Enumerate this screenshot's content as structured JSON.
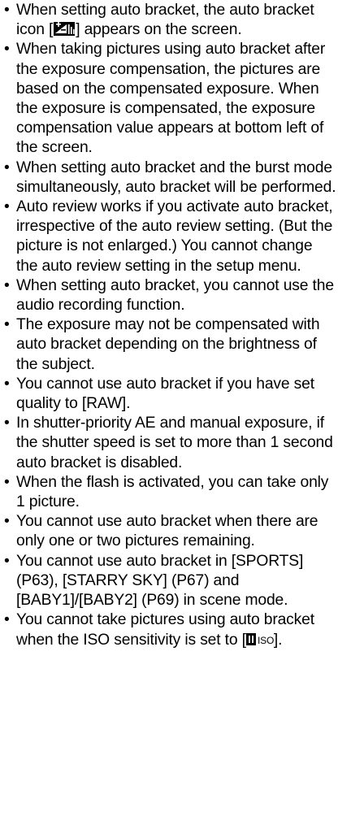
{
  "notes": {
    "bullet_glyph": "•",
    "items": [
      {
        "before": "When setting auto bracket, the auto bracket icon [",
        "icon": "auto-bracket-icon",
        "after": "] appears on the screen."
      },
      {
        "text": "When taking pictures using auto bracket after the exposure compensation, the pictures are based on the compensated exposure. When the exposure is compensated, the exposure compensation value appears at bottom left of the screen."
      },
      {
        "text": "When setting auto bracket and the burst mode simultaneously, auto bracket will be performed."
      },
      {
        "text": "Auto review works if you activate auto bracket, irrespective of the auto review setting. (But the picture is not enlarged.) You cannot change the auto review setting in the setup menu."
      },
      {
        "text": "When setting auto bracket, you cannot use the audio recording function."
      },
      {
        "text": "The exposure may not be compensated with auto bracket depending on the brightness of the subject."
      },
      {
        "text": "You cannot use auto bracket if you have set quality to [RAW]."
      },
      {
        "text": "In shutter-priority AE and manual exposure, if the shutter speed is set to more than 1 second auto bracket is disabled."
      },
      {
        "text": "When the flash is activated, you can take only 1 picture."
      },
      {
        "text": "You cannot use auto bracket when there are only one or two pictures remaining."
      },
      {
        "text": "You cannot use auto bracket in [SPORTS] (P63), [STARRY SKY] (P67) and [BABY1]/[BABY2] (P69) in scene mode."
      },
      {
        "before": "You cannot take pictures using auto bracket when the ISO sensitivity is set to [",
        "icon": "intelligent-iso-icon",
        "icon_text": "ISO",
        "after": "]."
      }
    ]
  }
}
